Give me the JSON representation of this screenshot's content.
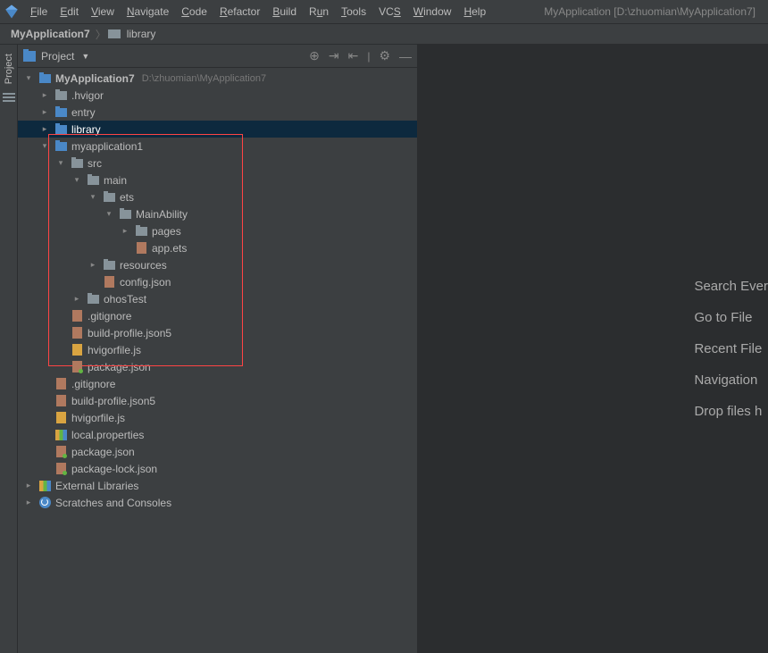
{
  "window_title": "MyApplication [D:\\zhuomian\\MyApplication7]",
  "menu": [
    "File",
    "Edit",
    "View",
    "Navigate",
    "Code",
    "Refactor",
    "Build",
    "Run",
    "Tools",
    "VCS",
    "Window",
    "Help"
  ],
  "breadcrumb": {
    "root": "MyApplication7",
    "items": [
      "library"
    ]
  },
  "panel": {
    "title": "Project",
    "tools": {
      "target": "⊕",
      "collapse": "⇥",
      "expand": "⇤",
      "gear": "⚙",
      "hide": "—"
    }
  },
  "sidebar_tab": "Project",
  "tree": {
    "root": {
      "label": "MyApplication7",
      "path": "D:\\zhuomian\\MyApplication7"
    },
    "hvigor": ".hvigor",
    "entry": "entry",
    "library": "library",
    "myapp1": {
      "label": "myapplication1",
      "src": "src",
      "main": "main",
      "ets": "ets",
      "mainability": "MainAbility",
      "pages": "pages",
      "appets": "app.ets",
      "resources": "resources",
      "configjson": "config.json",
      "ohostest": "ohosTest",
      "gitignore": ".gitignore",
      "buildprofile": "build-profile.json5",
      "hvigorfile": "hvigorfile.js",
      "packagejson": "package.json"
    },
    "root_files": {
      "gitignore": ".gitignore",
      "buildprofile": "build-profile.json5",
      "hvigorfile": "hvigorfile.js",
      "localprops": "local.properties",
      "packagejson": "package.json",
      "packagelock": "package-lock.json"
    },
    "external_libs": "External Libraries",
    "scratches": "Scratches and Consoles"
  },
  "welcome": {
    "search": "Search Ever",
    "goto": "Go to File",
    "recent": "Recent File",
    "nav": "Navigation",
    "drop": "Drop files h"
  }
}
